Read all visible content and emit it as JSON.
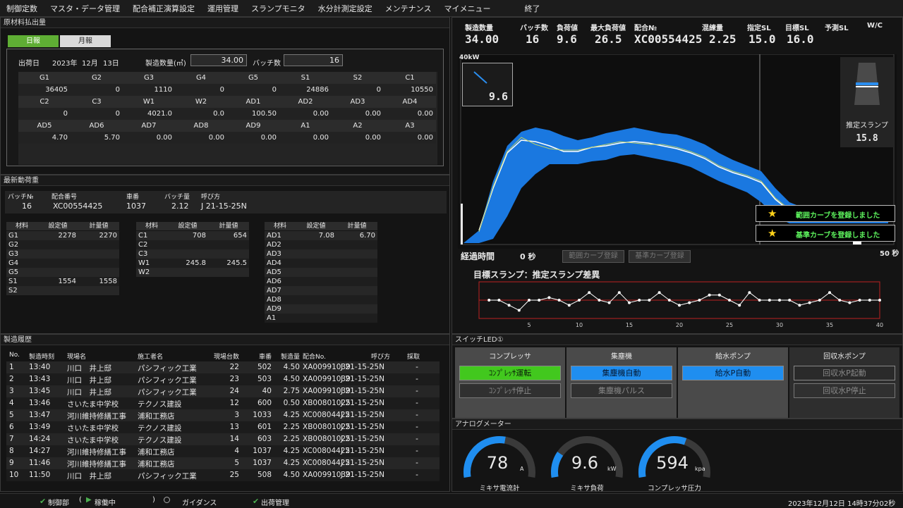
{
  "menu": [
    "制御定数",
    "マスタ・データ管理",
    "配合補正演算設定",
    "運用管理",
    "スランプモニタ",
    "水分計測定設定",
    "メンテナンス",
    "マイメニュー",
    "終了"
  ],
  "raw": {
    "title": "原材料払出量",
    "tab_daily": "日報",
    "tab_monthly": "月報",
    "date_label": "出荷日",
    "year": "2023年",
    "month": "12月",
    "day": "13日",
    "qty_label": "製造数量(㎥)",
    "qty": "34.00",
    "batch_label": "バッチ数",
    "batch": "16",
    "row1_h": [
      "G1",
      "G2",
      "G3",
      "G4",
      "G5",
      "S1",
      "S2",
      "C1"
    ],
    "row1_v": [
      "36405",
      "0",
      "1110",
      "0",
      "0",
      "24886",
      "0",
      "10550"
    ],
    "row2_h": [
      "C2",
      "C3",
      "W1",
      "W2",
      "AD1",
      "AD2",
      "AD3",
      "AD4"
    ],
    "row2_v": [
      "0",
      "0",
      "4021.0",
      "0.0",
      "100.50",
      "0.00",
      "0.00",
      "0.00"
    ],
    "row3_h": [
      "AD5",
      "AD6",
      "AD7",
      "AD8",
      "AD9",
      "A1",
      "A2",
      "A3"
    ],
    "row3_v": [
      "4.70",
      "5.70",
      "0.00",
      "0.00",
      "0.00",
      "0.00",
      "0.00",
      "0.00"
    ]
  },
  "latest": {
    "title": "最新動荷重",
    "h": [
      "バッチ№",
      "配合番号",
      "車番",
      "バッチ量",
      "呼び方"
    ],
    "v": [
      "16",
      "XC00554425",
      "1037",
      "2.12",
      "J 21-15-25N"
    ],
    "col_h": [
      "材料",
      "設定値",
      "計量値"
    ],
    "t1": [
      [
        "G1",
        "2278",
        "2270"
      ],
      [
        "G2",
        "",
        ""
      ],
      [
        "G3",
        "",
        ""
      ],
      [
        "G4",
        "",
        ""
      ],
      [
        "G5",
        "",
        ""
      ],
      [
        "S1",
        "1554",
        "1558"
      ],
      [
        "S2",
        "",
        ""
      ]
    ],
    "t2": [
      [
        "C1",
        "708",
        "654"
      ],
      [
        "C2",
        "",
        ""
      ],
      [
        "C3",
        "",
        ""
      ],
      [
        "W1",
        "245.8",
        "245.5"
      ],
      [
        "W2",
        "",
        ""
      ]
    ],
    "t3": [
      [
        "AD1",
        "7.08",
        "6.70"
      ],
      [
        "AD2",
        "",
        ""
      ],
      [
        "AD3",
        "",
        ""
      ],
      [
        "AD4",
        "",
        ""
      ],
      [
        "AD5",
        "",
        ""
      ],
      [
        "AD6",
        "",
        ""
      ],
      [
        "AD7",
        "",
        ""
      ],
      [
        "AD8",
        "",
        ""
      ],
      [
        "AD9",
        "",
        ""
      ],
      [
        "A1",
        "",
        ""
      ]
    ]
  },
  "history": {
    "title": "製造履歴",
    "h": [
      "No.",
      "製造時刻",
      "現場名",
      "施工者名",
      "現場台数",
      "車番",
      "製造量",
      "配合No.",
      "呼び方",
      "採取"
    ],
    "rows": [
      [
        "1",
        "13:40",
        "川口　井上邸",
        "パシフィック工業",
        "22",
        "502",
        "4.50",
        "XA00991039",
        "J 21-15-25N",
        "-"
      ],
      [
        "2",
        "13:43",
        "川口　井上邸",
        "パシフィック工業",
        "23",
        "503",
        "4.50",
        "XA00991039",
        "J 21-15-25N",
        "-"
      ],
      [
        "3",
        "13:45",
        "川口　井上邸",
        "パシフィック工業",
        "24",
        "40",
        "2.75",
        "XA00991039",
        "J 21-15-25N",
        "-"
      ],
      [
        "4",
        "13:46",
        "さいたま中学校",
        "テクノス建設",
        "12",
        "600",
        "0.50",
        "XB00801025",
        "J 21-15-25N",
        "-"
      ],
      [
        "5",
        "13:47",
        "河川維持修繕工事",
        "浦和工務店",
        "3",
        "1033",
        "4.25",
        "XC00804425",
        "J 21-15-25N",
        "-"
      ],
      [
        "6",
        "13:49",
        "さいたま中学校",
        "テクノス建設",
        "13",
        "601",
        "2.25",
        "XB00801025",
        "J 21-15-25N",
        "-"
      ],
      [
        "7",
        "14:24",
        "さいたま中学校",
        "テクノス建設",
        "14",
        "603",
        "2.25",
        "XB00801025",
        "J 21-15-25N",
        "-"
      ],
      [
        "8",
        "14:27",
        "河川維持修繕工事",
        "浦和工務店",
        "4",
        "1037",
        "4.25",
        "XC00804425",
        "J 21-15-25N",
        "-"
      ],
      [
        "9",
        "11:46",
        "河川維持修繕工事",
        "浦和工務店",
        "5",
        "1037",
        "4.25",
        "XC00804425",
        "J 21-15-25N",
        "-"
      ],
      [
        "10",
        "11:50",
        "川口　井上邸",
        "パシフィック工業",
        "25",
        "508",
        "4.50",
        "XA00991039",
        "J 21-15-25N",
        "-"
      ]
    ]
  },
  "slump": {
    "hdr": [
      "製造数量",
      "バッチ数",
      "負荷値",
      "最大負荷値",
      "配合№",
      "混練量",
      "指定SL",
      "目標SL",
      "予測SL",
      "W/C"
    ],
    "val": [
      "34.00",
      "16",
      "9.6",
      "26.5",
      "XC00554425",
      "2.25",
      "15.0",
      "16.0",
      "",
      ""
    ],
    "y_top": "40kW",
    "load_box": "9.6",
    "est_label": "推定スランプ",
    "est_val": "15.8",
    "range_msg": "範囲カーブを登録しました",
    "base_msg": "基準カーブを登録しました",
    "elapsed_label": "経過時間",
    "elapsed_val": "0 秒",
    "btn_range": "範囲カーブ登録",
    "btn_base": "基準カーブ登録",
    "x_end": "50 秒",
    "diff_title": "目標スランプ：推定スランプ差異",
    "diff_ticks": [
      "5",
      "10",
      "15",
      "20",
      "25",
      "30",
      "35",
      "40"
    ],
    "colors": {
      "band": "#1a78e0",
      "line": "#ffffff",
      "accent_green": "#34c21d"
    }
  },
  "chart_data": {
    "type": "line",
    "x": [
      1,
      2,
      3,
      4,
      5,
      6,
      7,
      8,
      9,
      10,
      11,
      12,
      13,
      14,
      15,
      16,
      17,
      18,
      19,
      20,
      21,
      22,
      23,
      24,
      25,
      26,
      27,
      28,
      29,
      30,
      31,
      32,
      33,
      34,
      35,
      36,
      37,
      38,
      39,
      40
    ],
    "values": [
      0,
      0,
      -0.6,
      -1.2,
      0,
      0,
      0.3,
      0,
      -0.6,
      0,
      0.9,
      0,
      -0.3,
      0.9,
      -0.3,
      0,
      0,
      0.9,
      0,
      -0.6,
      -0.3,
      0,
      0.6,
      0.6,
      0,
      -0.6,
      0.9,
      0,
      0,
      0,
      0,
      -0.6,
      -0.3,
      0,
      0.9,
      0,
      -0.3,
      0,
      0,
      0
    ],
    "xlim": [
      0,
      40
    ],
    "ylim": [
      -2,
      2
    ]
  },
  "led": {
    "title": "スイッチLED①",
    "cols": [
      {
        "name": "コンプレッサ",
        "b1": "ｺﾝﾌﾟﾚｯｻ運転",
        "b2": "ｺﾝﾌﾟﾚｯｻ停止"
      },
      {
        "name": "集塵機",
        "b1": "集塵機自動",
        "b2": "集塵機パルス"
      },
      {
        "name": "給水ポンプ",
        "b1": "給水P自動",
        "b2": ""
      },
      {
        "name": "回収水ポンプ",
        "b1": "回収水P起動",
        "b2": "回収水P停止"
      }
    ]
  },
  "meters": {
    "title": "アナログメーター",
    "items": [
      {
        "val": "78",
        "unit": "A",
        "label": "ミキサ電流計",
        "ratio": 0.55
      },
      {
        "val": "9.6",
        "unit": "kW",
        "label": "ミキサ負荷",
        "ratio": 0.22
      },
      {
        "val": "594",
        "unit": "kpa",
        "label": "コンプレッサ圧力",
        "ratio": 0.6
      }
    ]
  },
  "status": {
    "a": "制御部",
    "b": "(",
    "c": "稼働中",
    "d": ")",
    "e": "ガイダンス",
    "f": "出荷管理",
    "time": "2023年12月12日 14時37分02秒"
  }
}
